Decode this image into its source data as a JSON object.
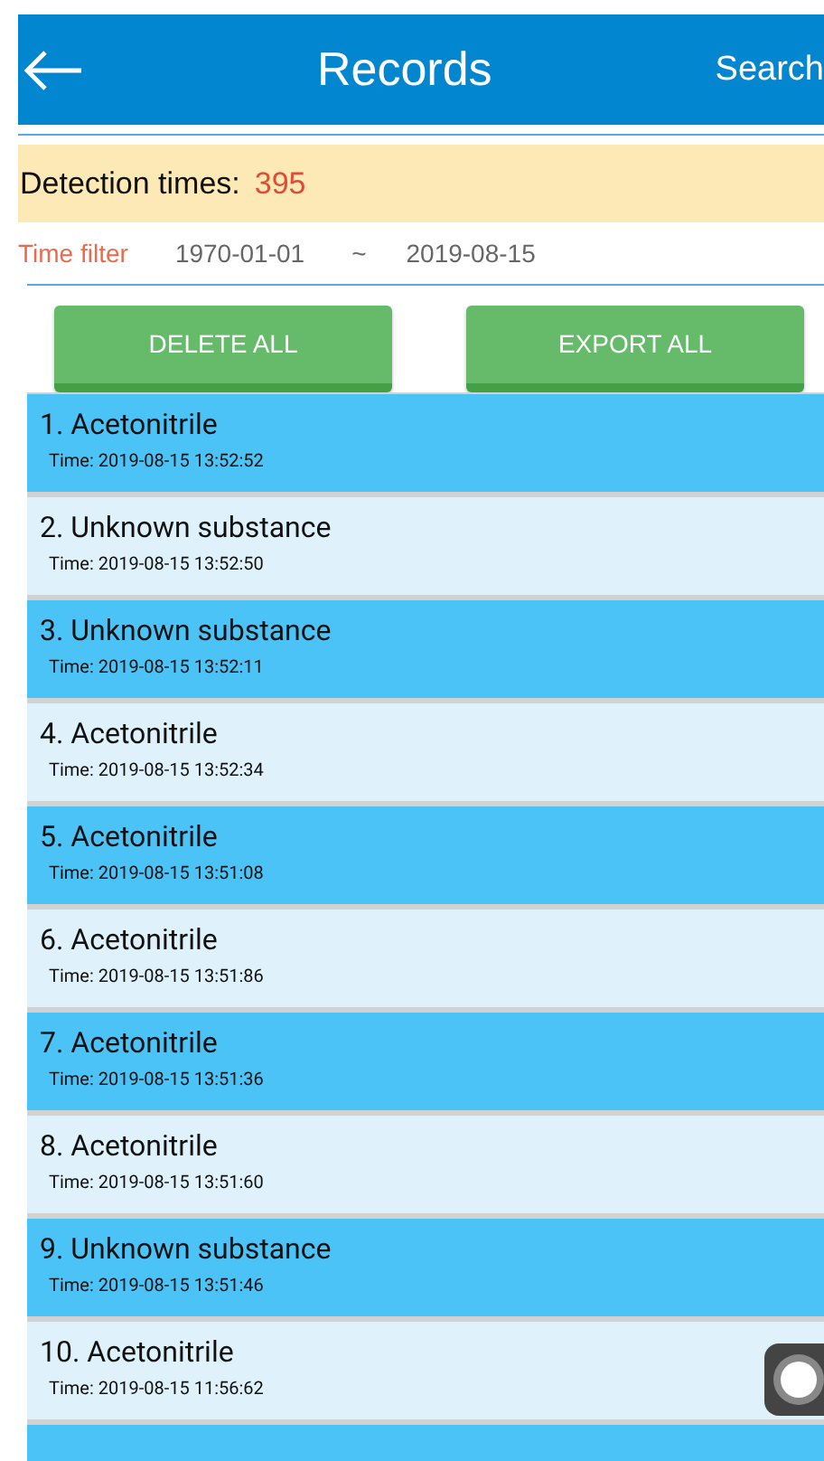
{
  "app_bar": {
    "title": "Records",
    "action": "Search"
  },
  "summary": {
    "label": "Detection times:",
    "count": "395"
  },
  "time_filter": {
    "label": "Time filter",
    "from": "1970-01-01",
    "separator": "~",
    "to": "2019-08-15"
  },
  "buttons": [
    "DELETE ALL",
    "EXPORT ALL"
  ],
  "records": [
    {
      "title": "1. Acetonitrile",
      "time": "Time: 2019-08-15 13:52:52"
    },
    {
      "title": "2. Unknown substance",
      "time": "Time: 2019-08-15 13:52:50"
    },
    {
      "title": "3. Unknown substance",
      "time": "Time: 2019-08-15 13:52:11"
    },
    {
      "title": "4. Acetonitrile",
      "time": "Time: 2019-08-15 13:52:34"
    },
    {
      "title": "5. Acetonitrile",
      "time": "Time: 2019-08-15 13:51:08"
    },
    {
      "title": "6. Acetonitrile",
      "time": "Time: 2019-08-15 13:51:86"
    },
    {
      "title": "7. Acetonitrile",
      "time": "Time: 2019-08-15 13:51:36"
    },
    {
      "title": "8. Acetonitrile",
      "time": "Time: 2019-08-15 13:51:60"
    },
    {
      "title": "9. Unknown substance",
      "time": "Time: 2019-08-15 13:51:46"
    },
    {
      "title": "10. Acetonitrile",
      "time": "Time: 2019-08-15 11:56:62"
    }
  ]
}
